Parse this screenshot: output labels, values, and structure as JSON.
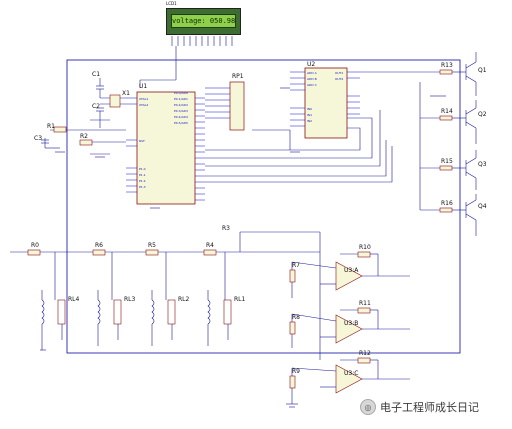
{
  "lcd": {
    "label": "LCD1",
    "display_text": "voltage: 050.98V"
  },
  "components": {
    "mcu": "U1",
    "adc": "U2",
    "resistor_pack": "RP1",
    "crystal": "X1",
    "capacitors": [
      "C1",
      "C2",
      "C3"
    ],
    "resistors_left": [
      "R1",
      "R2"
    ],
    "transistors": [
      "Q1",
      "Q2",
      "Q3",
      "Q4"
    ],
    "base_resistors": [
      "R13",
      "R14",
      "R15",
      "R16"
    ],
    "divider_resistors": [
      "R6",
      "R5",
      "R4",
      "R3"
    ],
    "input_resistor": "R0",
    "relays": [
      "RL4",
      "RL3",
      "RL2",
      "RL1"
    ],
    "opamps": [
      "U3:A",
      "U3:B",
      "U3:C"
    ],
    "opamp_resistors": [
      "R7",
      "R8",
      "R9",
      "R10",
      "R11",
      "R12"
    ]
  },
  "watermark": {
    "text": "电子工程师成长日记",
    "badge_icon": "wechat-icon"
  },
  "colors": {
    "wire": "#1a1a9a",
    "component": "#8a1010",
    "pin": "#1010cc",
    "lcd_bg": "#8fd04a",
    "lcd_frame": "#3e6d32"
  }
}
